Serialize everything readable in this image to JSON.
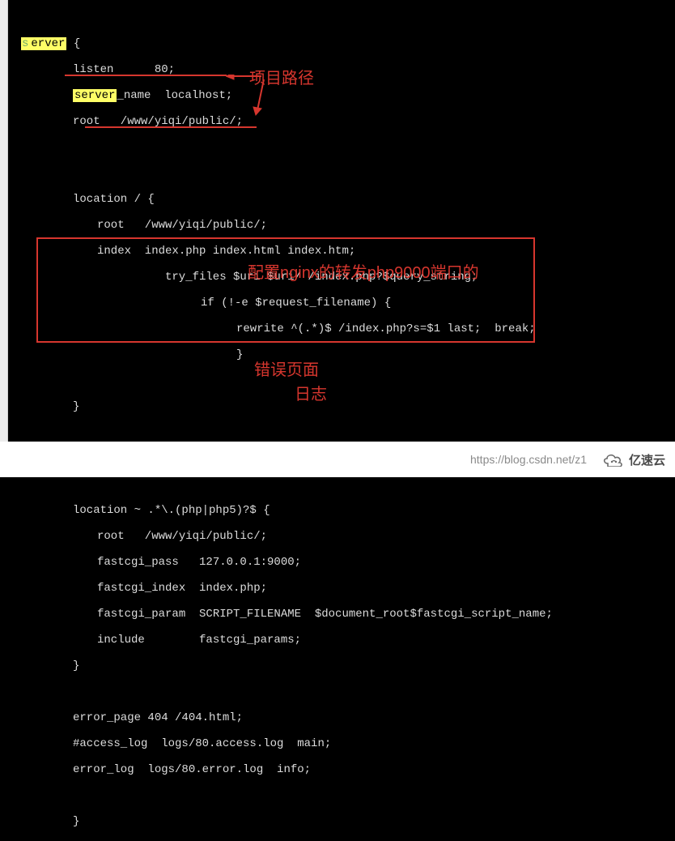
{
  "code": {
    "l1a": "s",
    "l1b": "erver",
    "l1c": " {",
    "l2": "listen      80;",
    "l3a": "server",
    "l3b": "_name  localhost;",
    "l4": "root   /www/yiqi/public/;",
    "l5": "",
    "l6": "location / {",
    "l7": "root   /www/yiqi/public/;",
    "l8": "index  index.php index.html index.htm;",
    "l9": "try_files $uri $uri/ /index.php?$query_string;",
    "l10": "if (!-e $request_filename) {",
    "l11": "rewrite ^(.*)$ /index.php?s=$1 last;  break;",
    "l12": "}",
    "l13": "}",
    "l14": "",
    "l15": "location ~ .*\\.(php|php5)?$ {",
    "l16": "root   /www/yiqi/public/;",
    "l17": "fastcgi_pass   127.0.0.1:9000;",
    "l18": "fastcgi_index  index.php;",
    "l19": "fastcgi_param  SCRIPT_FILENAME  $document_root$fastcgi_script_name;",
    "l20": "include        fastcgi_params;",
    "l21": "}",
    "l22": "",
    "l23": "error_page 404 /404.html;",
    "l24": "#access_log  logs/80.access.log  main;",
    "l25": "error_log  logs/80.error.log  info;",
    "l26": "",
    "l27": "}"
  },
  "annotations": {
    "project_path": "项目路径",
    "php_forward": "配置nginx的转发php9000端口的",
    "error_page": "错误页面",
    "log": "日志"
  },
  "watermark": {
    "csdn": "https://blog.csdn.net/z1",
    "yisu": "亿速云"
  }
}
